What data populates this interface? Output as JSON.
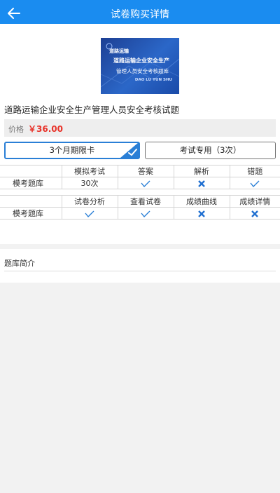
{
  "header": {
    "title": "试卷购买详情"
  },
  "cover": {
    "line1": "道路运输",
    "line2": "道路运输企业安全生产",
    "line3": "管理人员安全考核题库",
    "line4": "DAO LU YUN SHU"
  },
  "product": {
    "name": "道路运输企业安全生产管理人员安全考核试题",
    "price_label": "价格",
    "price": "￥36.00"
  },
  "options": [
    {
      "label": "3个月期限卡",
      "selected": true
    },
    {
      "label": "考试专用（3次）",
      "selected": false
    }
  ],
  "table1": {
    "headers": [
      "",
      "模拟考试",
      "答案",
      "解析",
      "错题"
    ],
    "row_label": "模考题库",
    "count": "30次",
    "marks": [
      "check-icon",
      "cross-icon",
      "check-icon"
    ]
  },
  "table2": {
    "headers": [
      "",
      "试卷分析",
      "查看试卷",
      "成绩曲线",
      "成绩详情"
    ],
    "row_label": "模考题库",
    "marks": [
      "check-icon",
      "check-icon",
      "cross-icon",
      "cross-icon"
    ]
  },
  "intro": {
    "title": "题库简介"
  },
  "colors": {
    "accent": "#1a8cf0",
    "price": "#e8332a",
    "check": "#2a7fd6"
  }
}
